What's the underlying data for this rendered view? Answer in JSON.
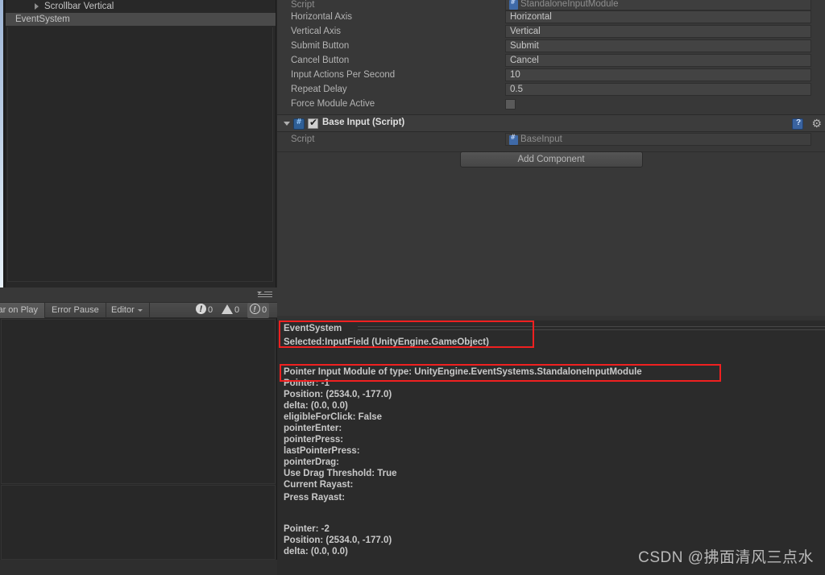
{
  "colors": {
    "accent_highlight": "#f02020",
    "panel_bg": "#383838",
    "dark_bg": "#282828",
    "row_selected": "#4a4a4a"
  },
  "hierarchy": {
    "items": [
      {
        "label": "Scrollbar Vertical",
        "indent": 2,
        "selected": false,
        "expandable": true
      },
      {
        "label": "EventSystem",
        "indent": 1,
        "selected": true,
        "expandable": false
      }
    ]
  },
  "inspector": {
    "properties": [
      {
        "label": "Script",
        "value": "StandaloneInputModule",
        "type": "object",
        "readonly": true,
        "icon": "cs-script-icon"
      },
      {
        "label": "Horizontal Axis",
        "value": "Horizontal",
        "type": "text"
      },
      {
        "label": "Vertical Axis",
        "value": "Vertical",
        "type": "text"
      },
      {
        "label": "Submit Button",
        "value": "Submit",
        "type": "text"
      },
      {
        "label": "Cancel Button",
        "value": "Cancel",
        "type": "text"
      },
      {
        "label": "Input Actions Per Second",
        "value": "10",
        "type": "number"
      },
      {
        "label": "Repeat Delay",
        "value": "0.5",
        "type": "number"
      },
      {
        "label": "Force Module Active",
        "value": "",
        "type": "checkbox",
        "checked": false
      }
    ],
    "component": {
      "title": "Base Input (Script)",
      "enabled": true,
      "expanded": true,
      "icon": "cs-script-icon",
      "help_icon": "help-book-icon",
      "gear_icon": "gear-icon",
      "script_label": "Script",
      "script_value": "BaseInput"
    },
    "add_component_label": "Add Component"
  },
  "console_toolbar": {
    "clear_on_play_label": "ar on Play",
    "error_pause_label": "Error Pause",
    "editor_label": "Editor",
    "counts": {
      "errors": "0",
      "warnings": "0",
      "infos": "0"
    }
  },
  "console_detail": {
    "title": "EventSystem",
    "subtitle": "Selected:InputField (UnityEngine.GameObject)",
    "pointer_module_line": "Pointer Input Module of type: UnityEngine.EventSystems.StandaloneInputModule",
    "block1": "Pointer: -1\nPosition: (2534.0, -177.0)\ndelta: (0.0, 0.0)\neligibleForClick: False\npointerEnter:\npointerPress:\nlastPointerPress:\npointerDrag:\nUse Drag Threshold: True\nCurrent Rayast:",
    "block2": "Press Rayast:",
    "block3": "Pointer: -2\nPosition: (2534.0, -177.0)\ndelta: (0.0, 0.0)"
  },
  "watermark": {
    "text": "CSDN @拂面清风三点水"
  }
}
